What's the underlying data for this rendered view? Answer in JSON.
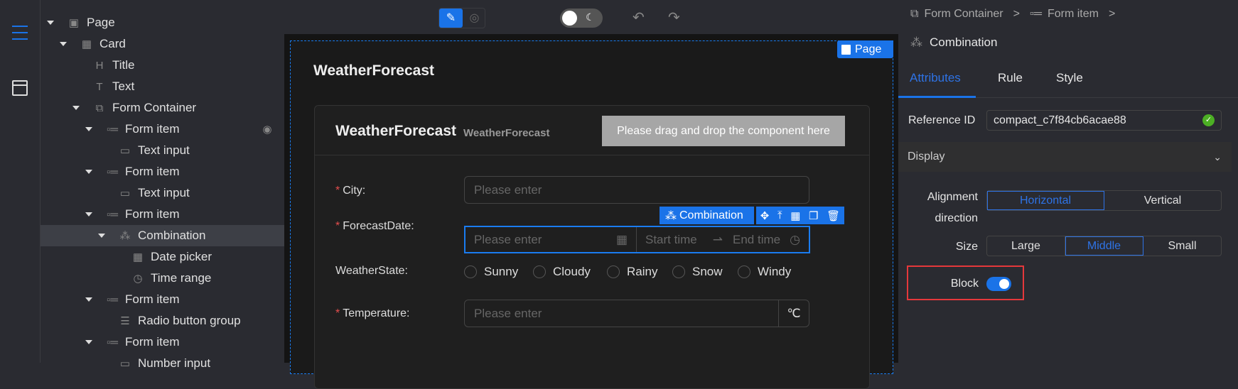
{
  "tree": {
    "items": [
      {
        "label": "Page",
        "icon": "page-icon",
        "depth": 0,
        "expanded": true
      },
      {
        "label": "Card",
        "icon": "card-icon",
        "depth": 1,
        "expanded": true
      },
      {
        "label": "Title",
        "icon": "heading-icon",
        "depth": 2
      },
      {
        "label": "Text",
        "icon": "text-icon",
        "depth": 2
      },
      {
        "label": "Form Container",
        "icon": "form-container-icon",
        "depth": 2,
        "expanded": true
      },
      {
        "label": "Form item",
        "icon": "form-item-icon",
        "depth": 3,
        "expanded": true,
        "eye": true
      },
      {
        "label": "Text input",
        "icon": "text-input-icon",
        "depth": 4
      },
      {
        "label": "Form item",
        "icon": "form-item-icon",
        "depth": 3,
        "expanded": true
      },
      {
        "label": "Text input",
        "icon": "text-input-icon",
        "depth": 4
      },
      {
        "label": "Form item",
        "icon": "form-item-icon",
        "depth": 3,
        "expanded": true
      },
      {
        "label": "Combination",
        "icon": "combination-icon",
        "depth": 4,
        "expanded": true,
        "selected": true
      },
      {
        "label": "Date picker",
        "icon": "calendar-icon",
        "depth": 5
      },
      {
        "label": "Time range",
        "icon": "clock-icon",
        "depth": 5
      },
      {
        "label": "Form item",
        "icon": "form-item-icon",
        "depth": 3,
        "expanded": true
      },
      {
        "label": "Radio button group",
        "icon": "radio-group-icon",
        "depth": 4
      },
      {
        "label": "Form item",
        "icon": "form-item-icon",
        "depth": 3,
        "expanded": true
      },
      {
        "label": "Number input",
        "icon": "number-input-icon",
        "depth": 4
      }
    ]
  },
  "canvas": {
    "page_badge": "Page",
    "page_title": "WeatherForecast",
    "card_title": "WeatherForecast",
    "card_subtitle": "WeatherForecast",
    "drop_zone": "Please drag and drop the component here",
    "selection_badge": "Combination",
    "fields": {
      "city": {
        "label": "City:",
        "required": true,
        "placeholder": "Please enter"
      },
      "date": {
        "label": "ForecastDate:",
        "required": true,
        "placeholder": "Please enter",
        "start": "Start time",
        "end": "End time"
      },
      "state": {
        "label": "WeatherState:",
        "options": [
          "Sunny",
          "Cloudy",
          "Rainy",
          "Snow",
          "Windy"
        ]
      },
      "temp": {
        "label": "Temperature:",
        "required": true,
        "placeholder": "Please enter",
        "suffix": "℃"
      }
    }
  },
  "right": {
    "breadcrumb": [
      "Form Container",
      "Form item"
    ],
    "sep": ">",
    "current": "Combination",
    "tabs": [
      "Attributes",
      "Rule",
      "Style"
    ],
    "active_tab": "Attributes",
    "ref_label": "Reference ID",
    "ref_value": "compact_c7f84cb6acae88",
    "section": "Display",
    "align_label": [
      "Alignment",
      "direction"
    ],
    "align_options": [
      "Horizontal",
      "Vertical"
    ],
    "size_label": "Size",
    "size_options": [
      "Large",
      "Middle",
      "Small"
    ],
    "block_label": "Block",
    "block_on": true
  },
  "colors": {
    "accent": "#1a73e8",
    "required": "#e34d4d",
    "ok": "#4caf24",
    "highlight": "#e5383b"
  }
}
